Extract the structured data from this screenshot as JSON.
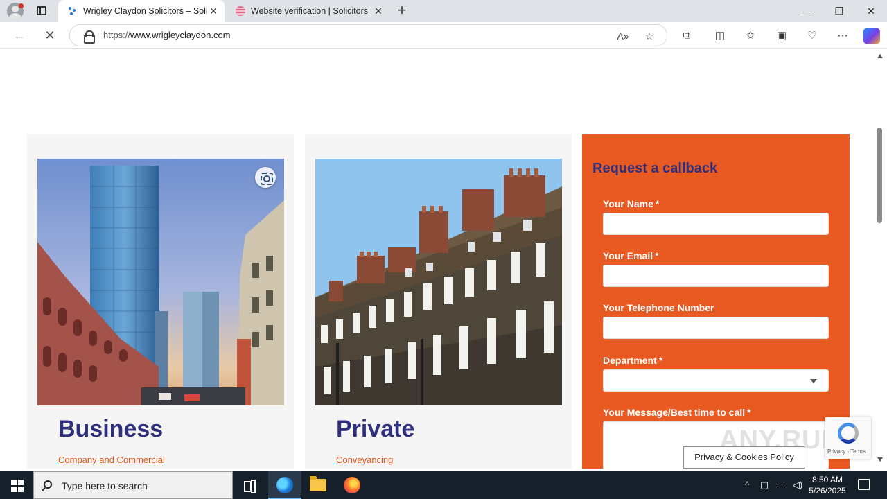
{
  "browser": {
    "tabs": [
      {
        "title": "Wrigley Claydon Solicitors – Solic",
        "active": true
      },
      {
        "title": "Website verification | Solicitors Re",
        "active": false
      }
    ],
    "url_protocol": "https://",
    "url_host": "www.wrigleyclaydon.com",
    "window_controls": {
      "minimize": "—",
      "restore": "❐",
      "close": "✕"
    }
  },
  "cards": [
    {
      "title": "Business",
      "link": "Company and Commercial"
    },
    {
      "title": "Private",
      "link": "Conveyancing"
    }
  ],
  "callback_form": {
    "title": "Request a callback",
    "fields": {
      "name": {
        "label": "Your Name",
        "required": "*"
      },
      "email": {
        "label": "Your Email",
        "required": "*"
      },
      "phone": {
        "label": "Your Telephone Number"
      },
      "department": {
        "label": "Department",
        "required": "*"
      },
      "message": {
        "label": "Your Message/Best time to call",
        "required": "*"
      }
    },
    "colors": {
      "panel": "#e85a22",
      "title": "#2e2f7d"
    }
  },
  "cookie_button": "Privacy & Cookies Policy",
  "recaptcha_terms": "Privacy - Terms",
  "watermark": "ANY.RUN",
  "taskbar": {
    "search_placeholder": "Type here to search",
    "time": "8:50 AM",
    "date": "5/26/2025"
  },
  "theme": {
    "brand_navy": "#2e2f7d",
    "brand_orange": "#e8561f"
  }
}
